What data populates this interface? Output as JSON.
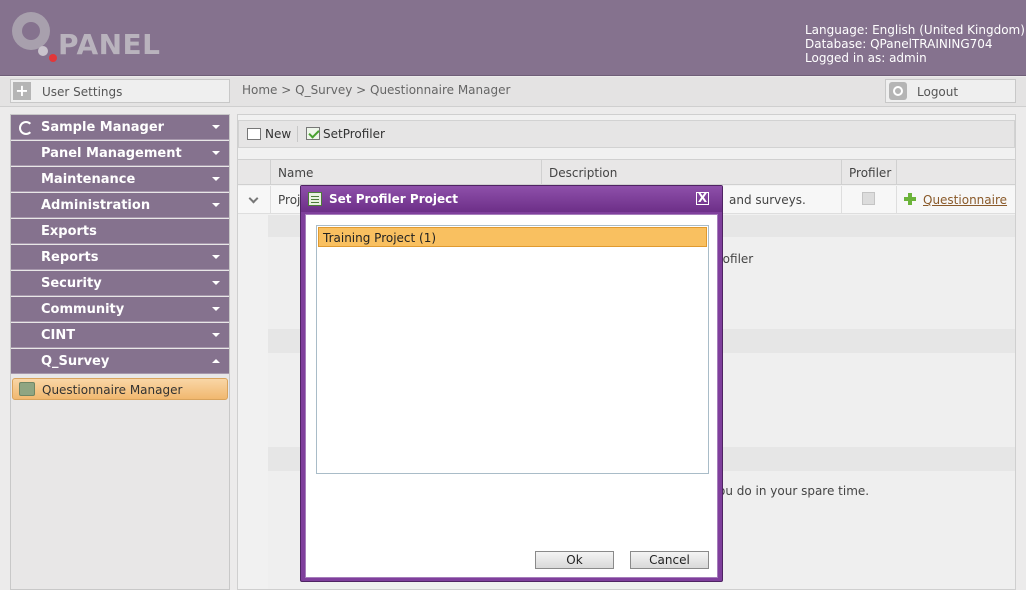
{
  "header": {
    "logo_text": "PANEL",
    "language": "Language: English (United Kingdom)",
    "database": "Database: QPanelTRAINING704",
    "logged_in": "Logged in as: admin"
  },
  "strip": {
    "user_settings": "User Settings",
    "breadcrumb": "Home > Q_Survey > Questionnaire Manager",
    "logout": "Logout"
  },
  "sidebar": {
    "items": [
      {
        "label": "Sample Manager"
      },
      {
        "label": "Panel Management"
      },
      {
        "label": "Maintenance"
      },
      {
        "label": "Administration"
      },
      {
        "label": "Exports"
      },
      {
        "label": "Reports"
      },
      {
        "label": "Security"
      },
      {
        "label": "Community"
      },
      {
        "label": "CINT"
      },
      {
        "label": "Q_Survey"
      }
    ],
    "sub_item": "Questionnaire Manager"
  },
  "toolbar": {
    "new_label": "New",
    "setprofiler_label": "SetProfiler"
  },
  "grid": {
    "columns": {
      "name": "Name",
      "description": "Description",
      "profiler": "Profiler"
    },
    "row": {
      "name": "Proj",
      "description": "and surveys.",
      "questionnaire_link": "Questionnaire"
    }
  },
  "background_text": {
    "profiler_text": "rofiler",
    "spare_time_text": "ou do in your spare time."
  },
  "modal": {
    "title": "Set Profiler Project",
    "close": "X",
    "list_items": [
      "Training Project (1)"
    ],
    "ok": "Ok",
    "cancel": "Cancel"
  },
  "colors": {
    "header_purple": "#85728e",
    "modal_purple": "#7f3f9c",
    "selection_orange": "#f9c060"
  }
}
